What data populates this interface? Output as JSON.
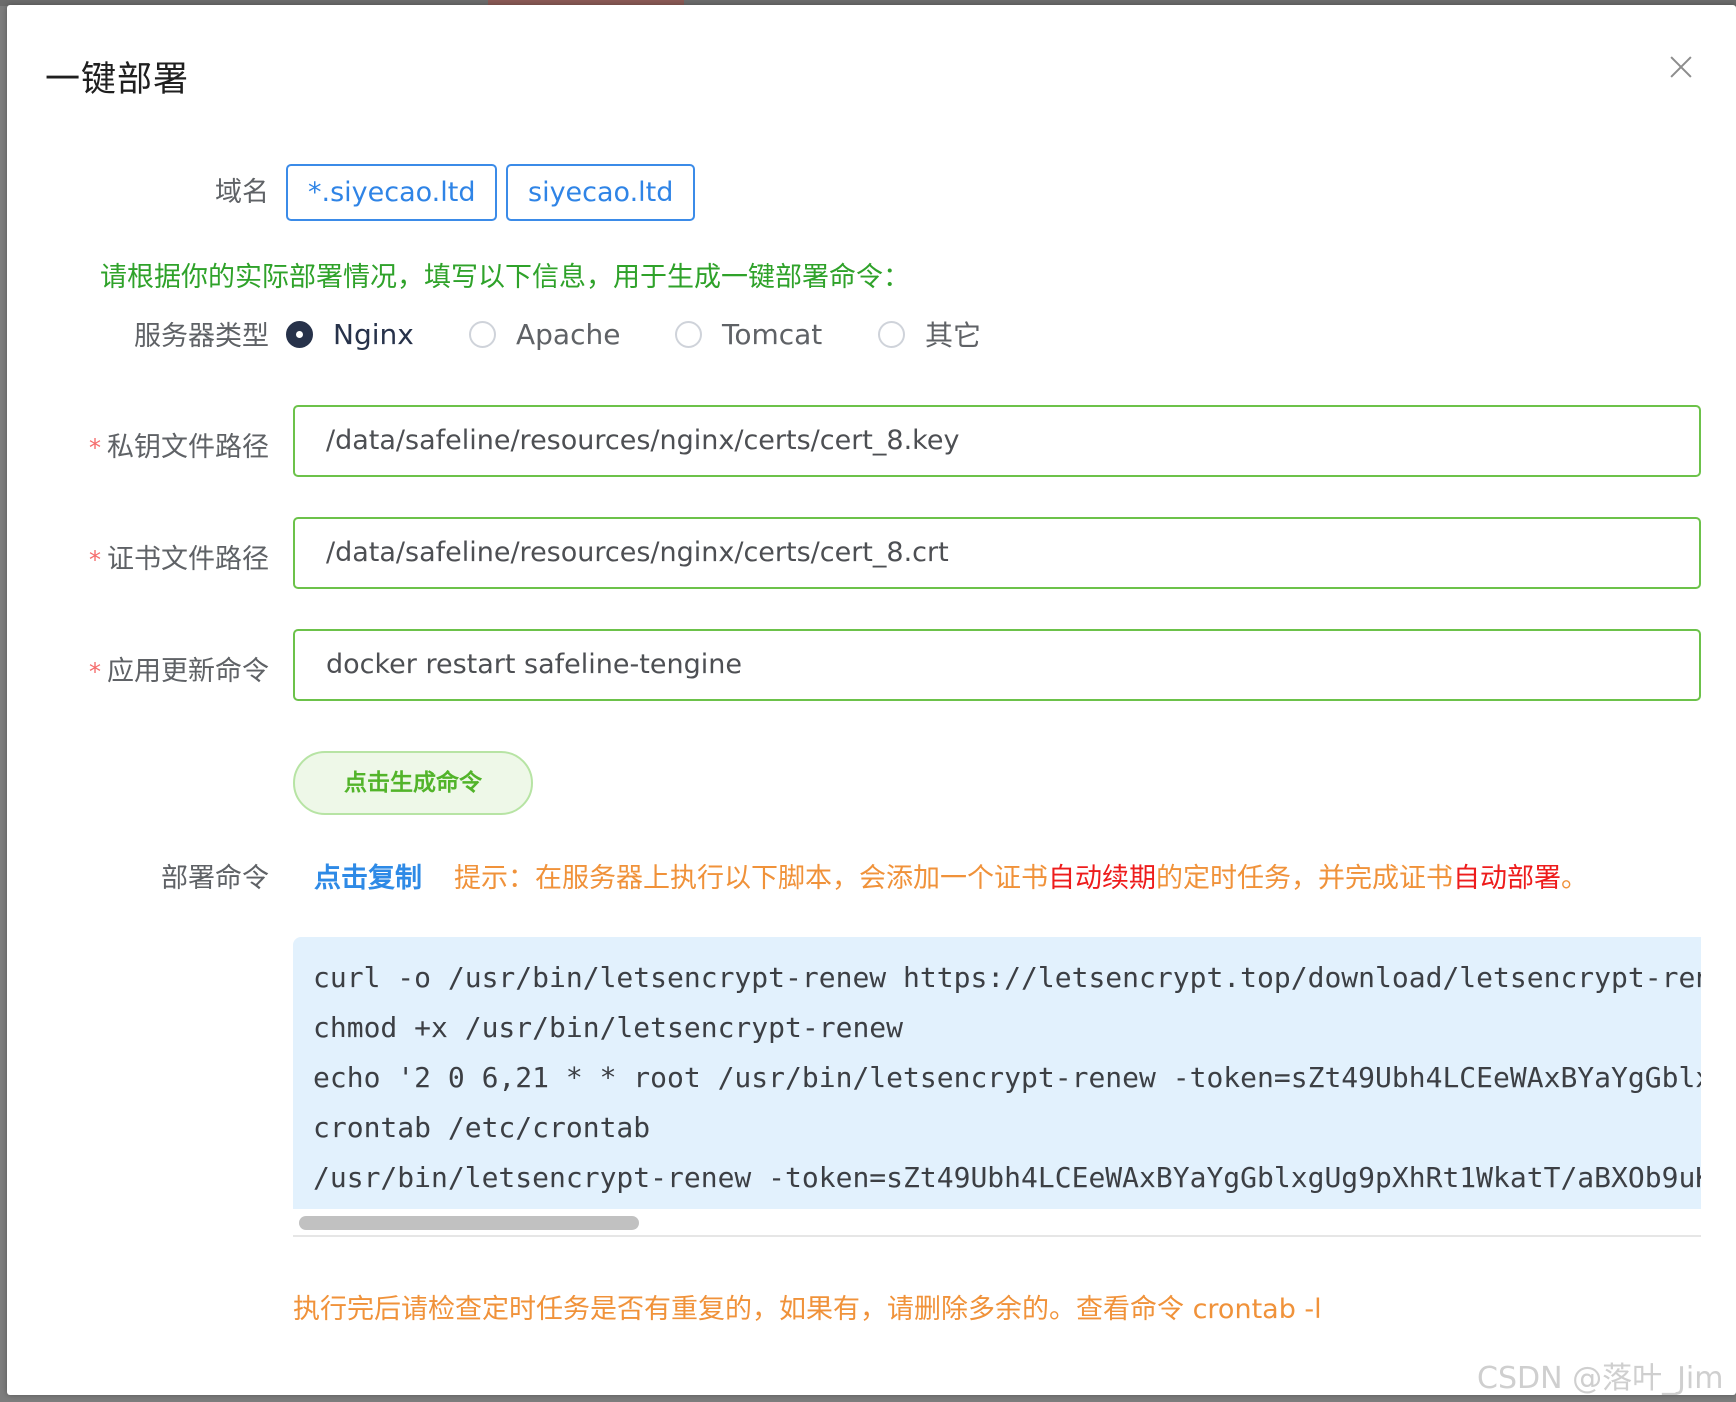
{
  "dialog": {
    "title": "一键部署"
  },
  "domain": {
    "label": "域名",
    "tags": [
      "*.siyecao.ltd",
      "siyecao.ltd"
    ]
  },
  "hint": "请根据你的实际部署情况，填写以下信息，用于生成一键部署命令：",
  "server_type": {
    "label": "服务器类型",
    "options": [
      "Nginx",
      "Apache",
      "Tomcat",
      "其它"
    ],
    "selected": "Nginx"
  },
  "fields": {
    "private_key": {
      "required_mark": "*",
      "label": "私钥文件路径",
      "value": "/data/safeline/resources/nginx/certs/cert_8.key"
    },
    "certificate": {
      "required_mark": "*",
      "label": "证书文件路径",
      "value": "/data/safeline/resources/nginx/certs/cert_8.crt"
    },
    "reload_cmd": {
      "required_mark": "*",
      "label": "应用更新命令",
      "value": "docker restart safeline-tengine"
    }
  },
  "generate_button": "点击生成命令",
  "deploy": {
    "label": "部署命令",
    "copy_link": "点击复制",
    "tip_parts": [
      "提示：在服务器上执行以下脚本，会添加一个证书",
      "自动续期",
      "的定时任务，并完成证书",
      "自动部署",
      "。"
    ],
    "lines": [
      "curl -o /usr/bin/letsencrypt-renew https://letsencrypt.top/download/letsencrypt-ren",
      "chmod +x /usr/bin/letsencrypt-renew",
      "echo '2 0 6,21 * * root /usr/bin/letsencrypt-renew -token=sZt49Ubh4LCEeWAxBYaYgGblx",
      "crontab /etc/crontab",
      "/usr/bin/letsencrypt-renew -token=sZt49Ubh4LCEeWAxBYaYgGblxgUg9pXhRt1WkatT/aBXOb9uK"
    ],
    "scroll_fraction": 0.24
  },
  "bottom_note": "执行完后请检查定时任务是否有重复的，如果有，请删除多余的。查看命令 crontab -l",
  "watermark": "CSDN @落叶_Jim",
  "colors": {
    "primary_blue": "#2f84e6",
    "success_green": "#6cc24a",
    "warning_orange": "#f0923a",
    "danger_red": "#ee1c1c",
    "radio_checked": "#27324a",
    "code_bg": "#e2f1fd"
  }
}
